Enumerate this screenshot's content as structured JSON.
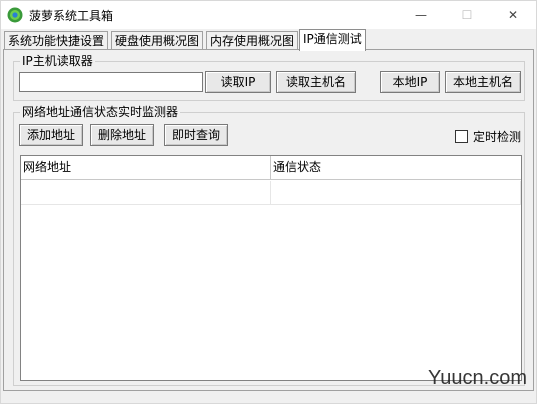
{
  "window": {
    "title": "菠萝系统工具箱",
    "minimize": "—",
    "maximize": "☐",
    "close": "✕"
  },
  "tabs": [
    {
      "label": "系统功能快捷设置"
    },
    {
      "label": "硬盘使用概况图"
    },
    {
      "label": "内存使用概况图"
    },
    {
      "label": "IP通信测试"
    }
  ],
  "ip_reader": {
    "group_label": "IP主机读取器",
    "input_value": "",
    "read_ip": "读取IP",
    "read_hostname": "读取主机名",
    "local_ip": "本地IP",
    "local_hostname": "本地主机名"
  },
  "monitor": {
    "group_label": "网络地址通信状态实时监测器",
    "add_address": "添加地址",
    "delete_address": "删除地址",
    "query_now": "即时查询",
    "timed_check": "定时检测",
    "columns": [
      "网络地址",
      "通信状态"
    ],
    "rows": [
      [
        "",
        ""
      ]
    ]
  },
  "watermark": "Yuucn.com"
}
